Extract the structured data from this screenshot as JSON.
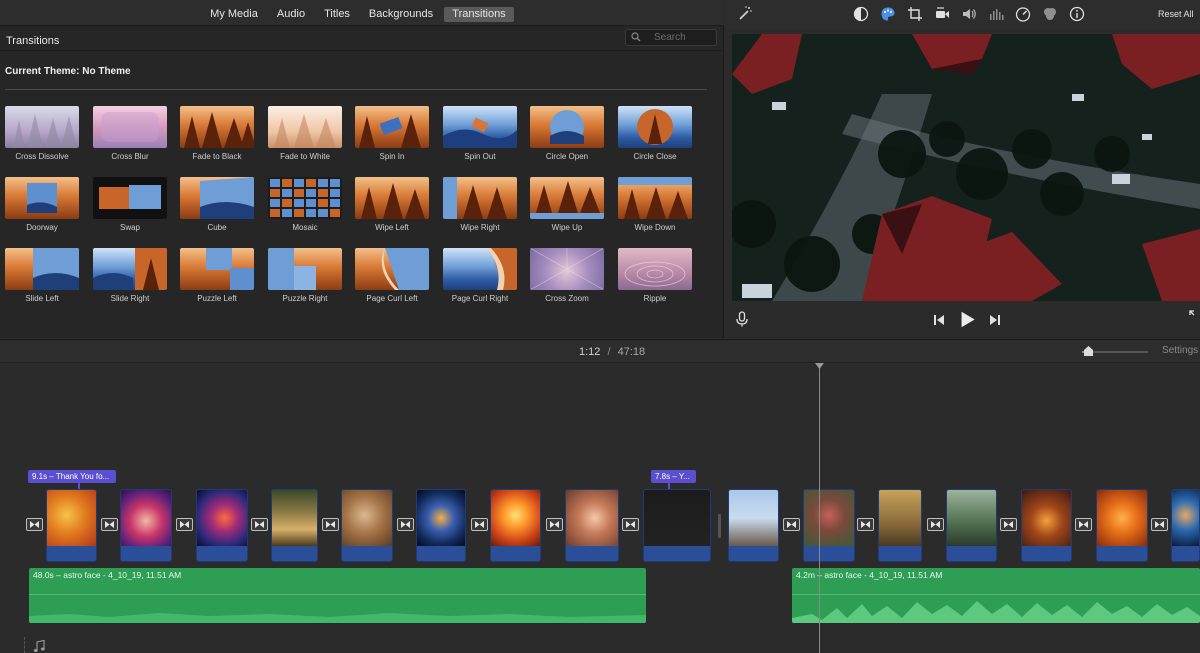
{
  "tabs": [
    {
      "label": "My Media"
    },
    {
      "label": "Audio"
    },
    {
      "label": "Titles"
    },
    {
      "label": "Backgrounds"
    },
    {
      "label": "Transitions"
    }
  ],
  "browser": {
    "title": "Transitions",
    "search_placeholder": "Search",
    "theme_label": "Current Theme: No Theme"
  },
  "transitions": [
    {
      "label": "Cross Dissolve"
    },
    {
      "label": "Cross Blur"
    },
    {
      "label": "Fade to Black"
    },
    {
      "label": "Fade to White"
    },
    {
      "label": "Spin In"
    },
    {
      "label": "Spin Out"
    },
    {
      "label": "Circle Open"
    },
    {
      "label": "Circle Close"
    },
    {
      "label": "Doorway"
    },
    {
      "label": "Swap"
    },
    {
      "label": "Cube"
    },
    {
      "label": "Mosaic"
    },
    {
      "label": "Wipe Left"
    },
    {
      "label": "Wipe Right"
    },
    {
      "label": "Wipe Up"
    },
    {
      "label": "Wipe Down"
    },
    {
      "label": "Slide Left"
    },
    {
      "label": "Slide Right"
    },
    {
      "label": "Puzzle Left"
    },
    {
      "label": "Puzzle Right"
    },
    {
      "label": "Page Curl Left"
    },
    {
      "label": "Page Curl Right"
    },
    {
      "label": "Cross Zoom"
    },
    {
      "label": "Ripple"
    }
  ],
  "viewer": {
    "reset_all": "Reset All",
    "tool_icons": [
      "magic-wand-icon",
      "color-balance-icon",
      "color-correction-icon",
      "crop-icon",
      "stabilization-icon",
      "volume-icon",
      "noise-reduction-icon",
      "speed-icon",
      "filter-icon",
      "info-icon"
    ]
  },
  "timeline": {
    "current_time": "1:12",
    "separator": "/",
    "total_time": "47:18",
    "settings_label": "Settings",
    "zoom_level": 0.1,
    "titles": [
      {
        "label": "9.1s – Thank You fo..."
      },
      {
        "label": "7.8s – Y..."
      }
    ],
    "audio_clips": [
      {
        "label": "48.0s – astro face - 4_10_19, 11.51 AM"
      },
      {
        "label": "4.2m – astro face - 4_10_19, 11.51 AM"
      }
    ],
    "music_icon": "music-note-icon"
  },
  "colors": {
    "audio_clip": "#2e9e55",
    "video_clip": "#2a4f98",
    "title_badge": "#5b4fd1",
    "active_tab": "#5a5a5a"
  }
}
